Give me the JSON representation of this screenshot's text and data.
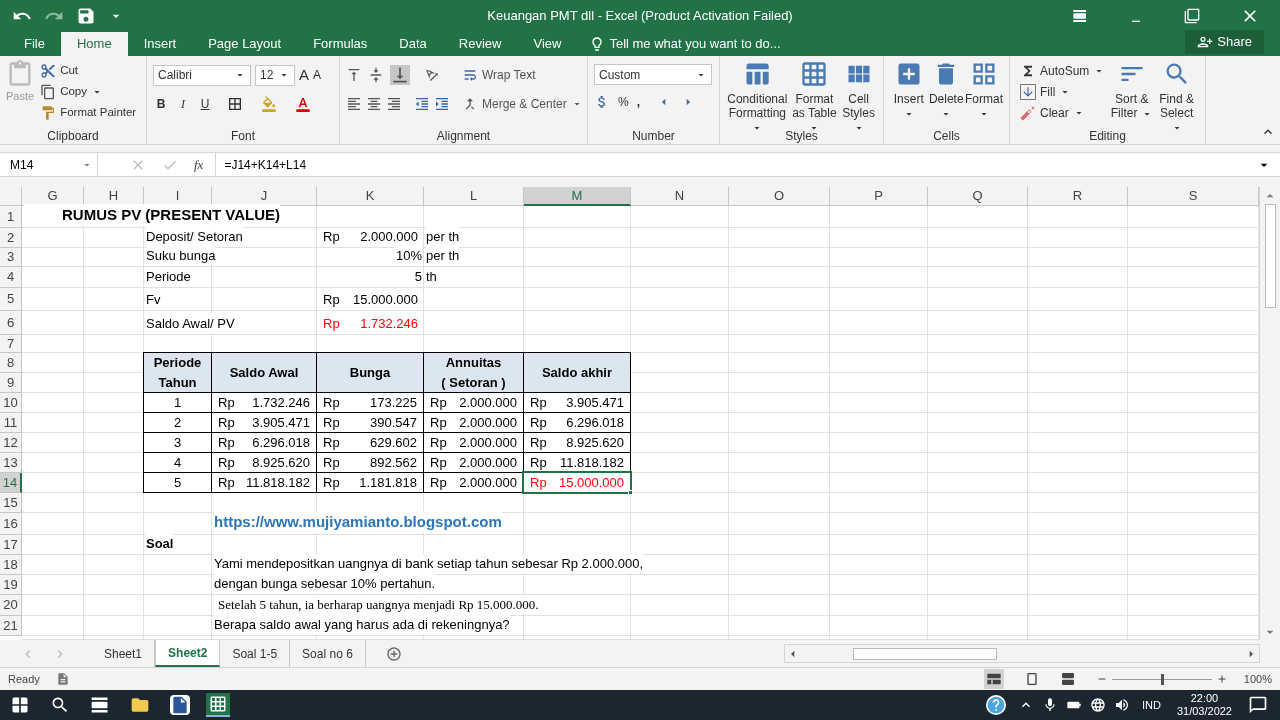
{
  "title_bar": {
    "title": "Keuangan PMT dll - Excel (Product Activation Failed)"
  },
  "menu_tabs": [
    {
      "label": "File",
      "selected": false
    },
    {
      "label": "Home",
      "selected": true
    },
    {
      "label": "Insert",
      "selected": false
    },
    {
      "label": "Page Layout",
      "selected": false
    },
    {
      "label": "Formulas",
      "selected": false
    },
    {
      "label": "Data",
      "selected": false
    },
    {
      "label": "Review",
      "selected": false
    },
    {
      "label": "View",
      "selected": false
    }
  ],
  "tell_me": "Tell me what you want to do...",
  "share": "Share",
  "ribbon": {
    "clipboard": {
      "label": "Clipboard",
      "paste": "Paste",
      "cut": "Cut",
      "copy": "Copy",
      "format_painter": "Format Painter"
    },
    "font": {
      "label": "Font",
      "font_name": "Calibri",
      "font_size": "12",
      "grow_font": "A",
      "shrink_font": "A",
      "bold": "B",
      "italic": "I",
      "underline": "U"
    },
    "alignment": {
      "label": "Alignment",
      "wrap_text": "Wrap Text",
      "merge_center": "Merge & Center"
    },
    "number": {
      "label": "Number",
      "format": "Custom",
      "percent": "%",
      "comma": ","
    },
    "styles": {
      "label": "Styles",
      "buttons": [
        "Conditional Formatting",
        "Format as Table",
        "Cell Styles"
      ]
    },
    "cells": {
      "label": "Cells",
      "buttons": [
        "Insert",
        "Delete",
        "Format"
      ]
    },
    "editing": {
      "label": "Editing",
      "autosum": "AutoSum",
      "fill": "Fill",
      "clear": "Clear",
      "buttons": [
        "Sort & Filter",
        "Find & Select"
      ]
    }
  },
  "formula_bar": {
    "name_box": "M14",
    "fx": "fx",
    "formula": "=J14+K14+L14"
  },
  "sheet": {
    "columns": [
      {
        "label": "G",
        "selected": false
      },
      {
        "label": "H",
        "selected": false
      },
      {
        "label": "I",
        "selected": false
      },
      {
        "label": "J",
        "selected": false
      },
      {
        "label": "K",
        "selected": false
      },
      {
        "label": "L",
        "selected": false
      },
      {
        "label": "M",
        "selected": true
      },
      {
        "label": "N",
        "selected": false
      },
      {
        "label": "O",
        "selected": false
      },
      {
        "label": "P",
        "selected": false
      },
      {
        "label": "Q",
        "selected": false
      },
      {
        "label": "R",
        "selected": false
      },
      {
        "label": "S",
        "selected": false
      }
    ],
    "rows": [
      {
        "label": "1",
        "selected": false,
        "cells": [
          {
            "kind": "title",
            "text": "RUMUS  PV (PRESENT  VALUE)",
            "selected": false,
            "red": false
          }
        ]
      },
      {
        "label": "2",
        "selected": false,
        "cells": [
          null,
          null,
          {
            "kind": "text",
            "text": "Deposit/ Setoran",
            "selected": false,
            "red": false
          },
          null,
          {
            "kind": "text",
            "currency": "Rp",
            "text": "2.000.000",
            "selected": false,
            "red": false
          },
          {
            "kind": "text",
            "text": "per th",
            "selected": false,
            "red": false
          }
        ]
      },
      {
        "label": "3",
        "selected": false,
        "cells": [
          null,
          null,
          {
            "kind": "text",
            "text": "Suku bunga",
            "selected": false,
            "red": false
          },
          null,
          {
            "kind": "number",
            "text": "10%",
            "selected": false,
            "red": false
          },
          {
            "kind": "text",
            "text": "per th",
            "selected": false,
            "red": false
          }
        ]
      },
      {
        "label": "4",
        "selected": false,
        "cells": [
          null,
          null,
          {
            "kind": "text",
            "text": "Periode",
            "selected": false,
            "red": false
          },
          null,
          {
            "kind": "number",
            "text": "5",
            "selected": false,
            "red": false
          },
          {
            "kind": "text",
            "text": "th",
            "selected": false,
            "red": false
          }
        ]
      },
      {
        "label": "5",
        "selected": false,
        "cells": [
          null,
          null,
          {
            "kind": "text",
            "text": "Fv",
            "selected": false,
            "red": false
          },
          null,
          {
            "kind": "text",
            "currency": "Rp",
            "text": "15.000.000",
            "selected": false,
            "red": false
          }
        ]
      },
      {
        "label": "6",
        "selected": false,
        "cells": [
          null,
          null,
          {
            "kind": "text",
            "text": "Saldo Awal/ PV",
            "selected": false,
            "red": false
          },
          null,
          {
            "kind": "text",
            "currency": "Rp",
            "text": "1.732.246",
            "selected": false,
            "red": true
          }
        ]
      },
      {
        "label": "7",
        "selected": false
      },
      {
        "label": "8",
        "selected": false,
        "cells": [
          null,
          null,
          {
            "kind": "header",
            "text": "Periode\nTahun",
            "selected": false,
            "red": false
          },
          {
            "kind": "header",
            "text": "Saldo Awal",
            "selected": false,
            "red": false
          },
          {
            "kind": "header",
            "text": "Bunga",
            "selected": false,
            "red": false
          },
          {
            "kind": "header",
            "text": "Annuitas\n( Setoran )",
            "selected": false,
            "red": false
          },
          {
            "kind": "header",
            "text": "Saldo akhir",
            "selected": false,
            "red": false
          }
        ]
      },
      {
        "label": "9",
        "selected": false
      },
      {
        "label": "10",
        "selected": false,
        "cells": [
          null,
          null,
          {
            "kind": "index",
            "text": "1",
            "selected": false,
            "red": false
          },
          {
            "kind": "table",
            "currency": "Rp",
            "text": "1.732.246",
            "selected": false,
            "red": false
          },
          {
            "kind": "table",
            "currency": "Rp",
            "text": "173.225",
            "selected": false,
            "red": false
          },
          {
            "kind": "table",
            "currency": "Rp",
            "text": "2.000.000",
            "selected": false,
            "red": false
          },
          {
            "kind": "table",
            "currency": "Rp",
            "text": "3.905.471",
            "selected": false,
            "red": false
          }
        ]
      },
      {
        "label": "11",
        "selected": false,
        "cells": [
          null,
          null,
          {
            "kind": "index",
            "text": "2",
            "selected": false,
            "red": false
          },
          {
            "kind": "table",
            "currency": "Rp",
            "text": "3.905.471",
            "selected": false,
            "red": false
          },
          {
            "kind": "table",
            "currency": "Rp",
            "text": "390.547",
            "selected": false,
            "red": false
          },
          {
            "kind": "table",
            "currency": "Rp",
            "text": "2.000.000",
            "selected": false,
            "red": false
          },
          {
            "kind": "table",
            "currency": "Rp",
            "text": "6.296.018",
            "selected": false,
            "red": false
          }
        ]
      },
      {
        "label": "12",
        "selected": false,
        "cells": [
          null,
          null,
          {
            "kind": "index",
            "text": "3",
            "selected": false,
            "red": false
          },
          {
            "kind": "table",
            "currency": "Rp",
            "text": "6.296.018",
            "selected": false,
            "red": false
          },
          {
            "kind": "table",
            "currency": "Rp",
            "text": "629.602",
            "selected": false,
            "red": false
          },
          {
            "kind": "table",
            "currency": "Rp",
            "text": "2.000.000",
            "selected": false,
            "red": false
          },
          {
            "kind": "table",
            "currency": "Rp",
            "text": "8.925.620",
            "selected": false,
            "red": false
          }
        ]
      },
      {
        "label": "13",
        "selected": false,
        "cells": [
          null,
          null,
          {
            "kind": "index",
            "text": "4",
            "selected": false,
            "red": false
          },
          {
            "kind": "table",
            "currency": "Rp",
            "text": "8.925.620",
            "selected": false,
            "red": false
          },
          {
            "kind": "table",
            "currency": "Rp",
            "text": "892.562",
            "selected": false,
            "red": false
          },
          {
            "kind": "table",
            "currency": "Rp",
            "text": "2.000.000",
            "selected": false,
            "red": false
          },
          {
            "kind": "table",
            "currency": "Rp",
            "text": "11.818.182",
            "selected": false,
            "red": false
          }
        ]
      },
      {
        "label": "14",
        "selected": true,
        "cells": [
          null,
          null,
          {
            "kind": "index",
            "text": "5",
            "selected": false,
            "red": false
          },
          {
            "kind": "table",
            "currency": "Rp",
            "text": "11.818.182",
            "selected": false,
            "red": false
          },
          {
            "kind": "table",
            "currency": "Rp",
            "text": "1.181.818",
            "selected": false,
            "red": false
          },
          {
            "kind": "table",
            "currency": "Rp",
            "text": "2.000.000",
            "selected": false,
            "red": false
          },
          {
            "kind": "table",
            "currency": "Rp",
            "text": "15.000.000",
            "selected": true,
            "red": true
          }
        ]
      },
      {
        "label": "15",
        "selected": false
      },
      {
        "label": "16",
        "selected": false,
        "cells": [
          null,
          null,
          null,
          {
            "kind": "link",
            "text": "https://www.mujiyamianto.blogspot.com",
            "selected": false,
            "red": false
          }
        ]
      },
      {
        "label": "17",
        "selected": false,
        "cells": [
          null,
          null,
          {
            "kind": "bold",
            "text": "Soal",
            "selected": false,
            "red": false
          }
        ]
      },
      {
        "label": "18",
        "selected": false,
        "cells": [
          null,
          null,
          null,
          {
            "kind": "text",
            "text": "Yami mendepositkan uangnya di bank setiap  tahun sebesar Rp 2.000.000,",
            "selected": false,
            "red": false
          }
        ]
      },
      {
        "label": "19",
        "selected": false,
        "cells": [
          null,
          null,
          null,
          {
            "kind": "text",
            "text": "dengan bunga sebesar 10% pertahun.",
            "selected": false,
            "red": false
          }
        ]
      },
      {
        "label": "20",
        "selected": false,
        "cells": [
          null,
          null,
          null,
          {
            "kind": "serif",
            "text": "Setelah 5 tahun, ia berharap uangnya menjadi Rp 15.000.000.",
            "selected": false,
            "red": false
          }
        ]
      },
      {
        "label": "21",
        "selected": false,
        "cells": [
          null,
          null,
          null,
          {
            "kind": "text",
            "text": "Berapa saldo awal yang harus ada di rekeningnya?",
            "selected": false,
            "red": false
          }
        ]
      }
    ]
  },
  "sheet_tabs": [
    {
      "label": "Sheet1",
      "selected": false
    },
    {
      "label": "Sheet2",
      "selected": true
    },
    {
      "label": "Soal 1-5",
      "selected": false
    },
    {
      "label": "Soal no 6",
      "selected": false
    }
  ],
  "status_bar": {
    "text": "Ready",
    "zoom": "100%",
    "zoom_slider": {
      "level": 0.5
    }
  },
  "taskbar": {
    "language": "IND",
    "time": "22:00",
    "date": "31/03/2022"
  }
}
